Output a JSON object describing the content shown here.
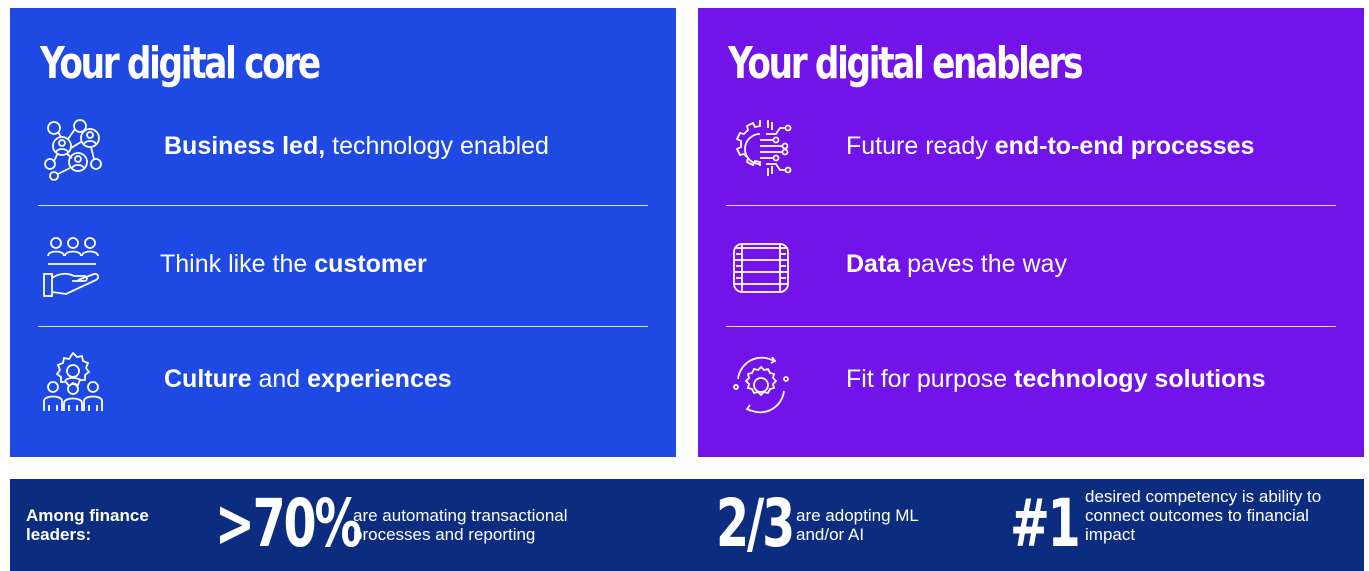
{
  "core": {
    "title": "Your digital core",
    "items": [
      {
        "icon": "network-people-icon",
        "bold": "Business led,",
        "rest": " technology enabled"
      },
      {
        "icon": "hand-people-icon",
        "pre": "Think like the ",
        "bold": "customer"
      },
      {
        "icon": "team-gear-icon",
        "bold1": "Culture",
        "mid": " and ",
        "bold2": "experiences"
      }
    ]
  },
  "enablers": {
    "title": "Your digital enablers",
    "items": [
      {
        "icon": "circuit-gear-icon",
        "pre": "Future ready ",
        "bold": "end-to-end processes"
      },
      {
        "icon": "database-icon",
        "bold": "Data",
        "rest": " paves the way"
      },
      {
        "icon": "cycle-gear-icon",
        "pre": "Fit for purpose ",
        "bold": "technology solutions"
      }
    ]
  },
  "stats": {
    "lead": "Among finance leaders:",
    "items": [
      {
        "value": ">70%",
        "desc": "are automating transactional processes and reporting"
      },
      {
        "value": "2/3",
        "desc": "are adopting ML and/or AI"
      },
      {
        "value": "#1",
        "desc": "desired competency is ability to connect outcomes to financial impact"
      }
    ]
  },
  "colors": {
    "core_bg": "#1e49e2",
    "enablers_bg": "#7213ea",
    "stats_bg": "#0c2d7f",
    "text": "#ffffff"
  }
}
